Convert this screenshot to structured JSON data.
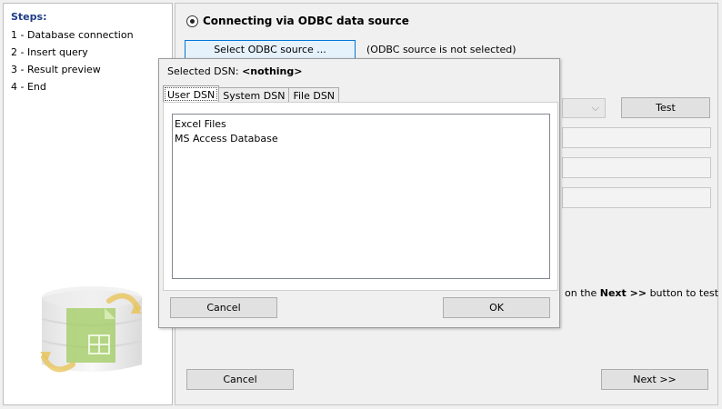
{
  "steps": {
    "title": "Steps:",
    "items": [
      "1 - Database connection",
      "2 - Insert query",
      "3 - Result preview",
      "4 - End"
    ]
  },
  "connection": {
    "radio_label": "Connecting via ODBC data source",
    "select_button": "Select ODBC source ...",
    "status": "(ODBC source is not selected)",
    "test_button": "Test",
    "hint_prefix": "on the",
    "hint_bold": "Next >>",
    "hint_suffix": "button to test"
  },
  "footer": {
    "cancel": "Cancel",
    "next": "Next >>"
  },
  "dsn_dialog": {
    "selected_label": "Selected DSN:",
    "selected_value": "<nothing>",
    "tabs": [
      "User DSN",
      "System DSN",
      "File DSN"
    ],
    "items": [
      "Excel Files",
      "MS Access Database"
    ],
    "cancel": "Cancel",
    "ok": "OK"
  },
  "icons": {
    "combo_arrow": "chevron-down-icon",
    "db_graphic": "database-sync-icon"
  },
  "colors": {
    "steps_title": "#1f3c88",
    "select_button_border": "#0078d7",
    "select_button_bg": "#e5f1fb"
  }
}
